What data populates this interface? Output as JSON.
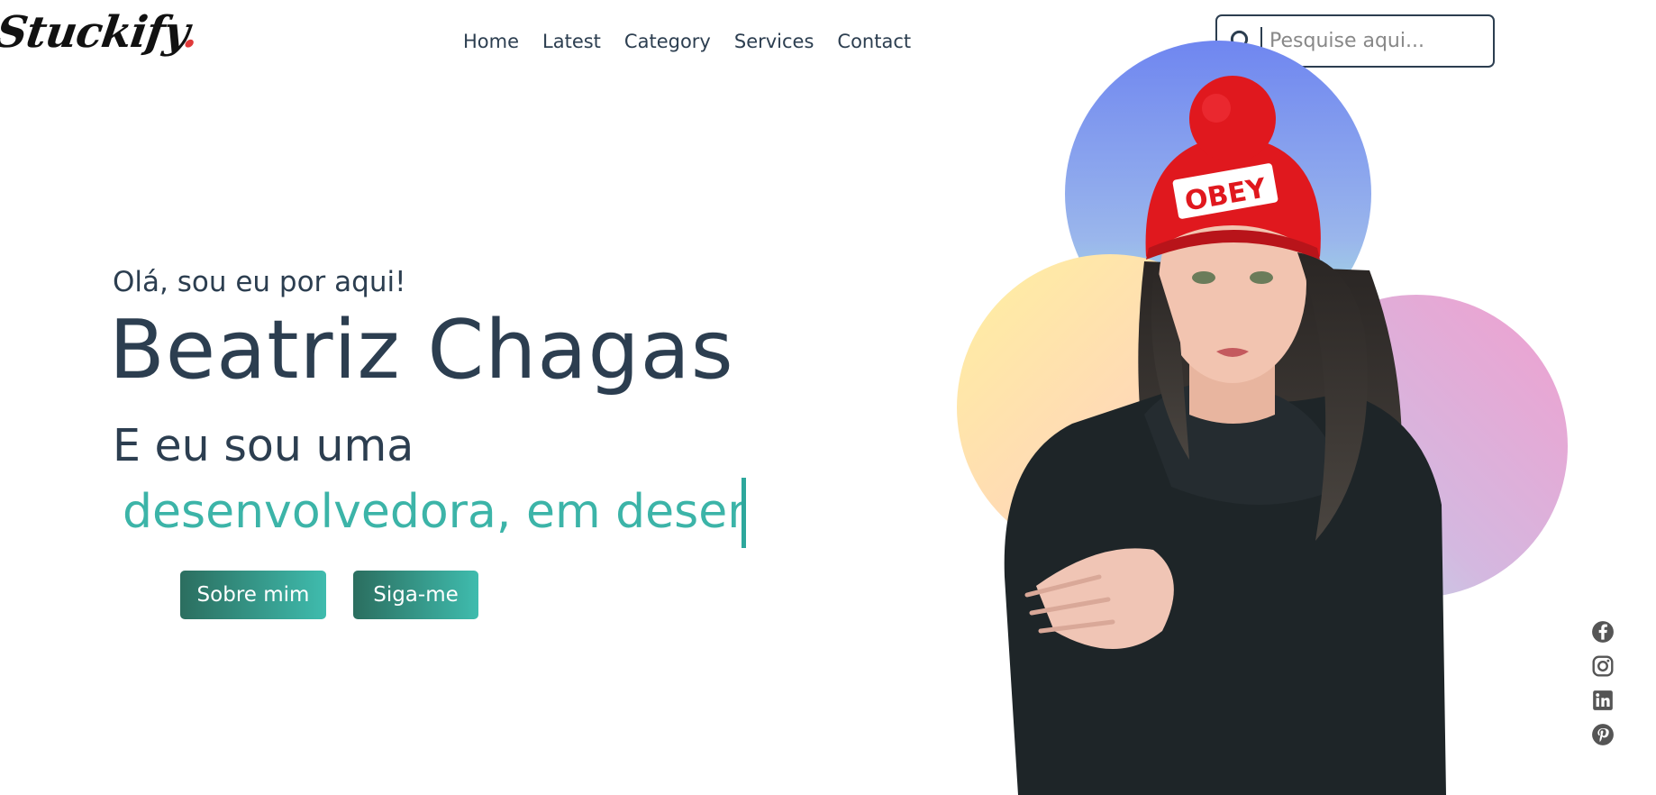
{
  "brand": {
    "logo_text": "Stuckify",
    "logo_dot": ".",
    "dot_color": "#e03a3a"
  },
  "nav": {
    "items": [
      {
        "label": "Home"
      },
      {
        "label": "Latest"
      },
      {
        "label": "Category"
      },
      {
        "label": "Services"
      },
      {
        "label": "Contact"
      }
    ]
  },
  "search": {
    "placeholder": "Pesquise aqui...",
    "value": "",
    "icon": "search-icon"
  },
  "hero": {
    "greeting": "Olá, sou eu por aqui!",
    "name": "Beatriz Chagas",
    "subtitle": "E eu sou uma",
    "typing_text": "desenvolvedora, em desenv",
    "typing_color": "#3cb4a8",
    "buttons": {
      "about": "Sobre mim",
      "follow": "Siga-me"
    }
  },
  "social": [
    "facebook-icon",
    "instagram-icon",
    "linkedin-icon",
    "pinterest-icon"
  ],
  "colors": {
    "text": "#2c3e50",
    "accent": "#3cb4a8",
    "button_start": "#2b6e5f",
    "button_end": "#3fbcae"
  }
}
